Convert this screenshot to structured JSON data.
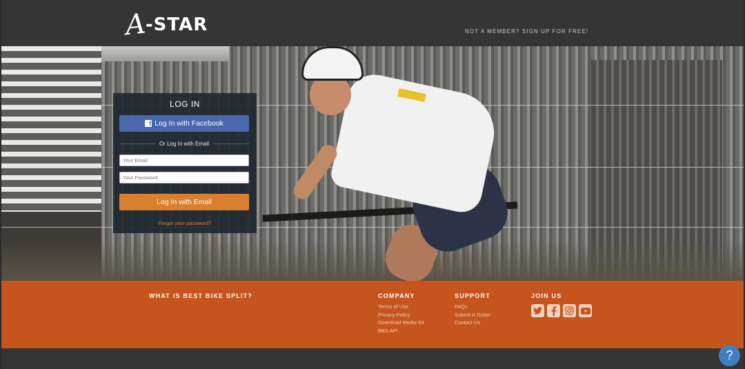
{
  "header": {
    "logo_text": "-STAR",
    "logo_mark": "A",
    "signup_link": "NOT A MEMBER? SIGN UP FOR FREE!"
  },
  "login": {
    "title": "LOG IN",
    "facebook_button": "Log In with Facebook",
    "divider_text": "Or Log In with Email",
    "email_placeholder": "Your Email",
    "password_placeholder": "Your Password",
    "email_button": "Log In with Email",
    "forgot_link": "Forgot your password?"
  },
  "footer": {
    "about_heading": "WHAT IS BEST BIKE SPLIT?",
    "company": {
      "heading": "COMPANY",
      "links": [
        "Terms of Use",
        "Privacy Policy",
        "Download Media Kit",
        "BBS API"
      ]
    },
    "support": {
      "heading": "SUPPORT",
      "links": [
        "FAQs",
        "Submit A Ticket",
        "Contact Us"
      ]
    },
    "join": {
      "heading": "JOIN US",
      "icons": [
        "twitter-icon",
        "facebook-icon",
        "instagram-icon",
        "youtube-icon"
      ]
    }
  },
  "help": {
    "label": "?"
  },
  "colors": {
    "header_bg": "#353535",
    "footer_bg": "#c5541d",
    "facebook_blue": "#4a67ad",
    "accent_orange": "#d9802f",
    "help_blue": "#3f7fc0"
  }
}
